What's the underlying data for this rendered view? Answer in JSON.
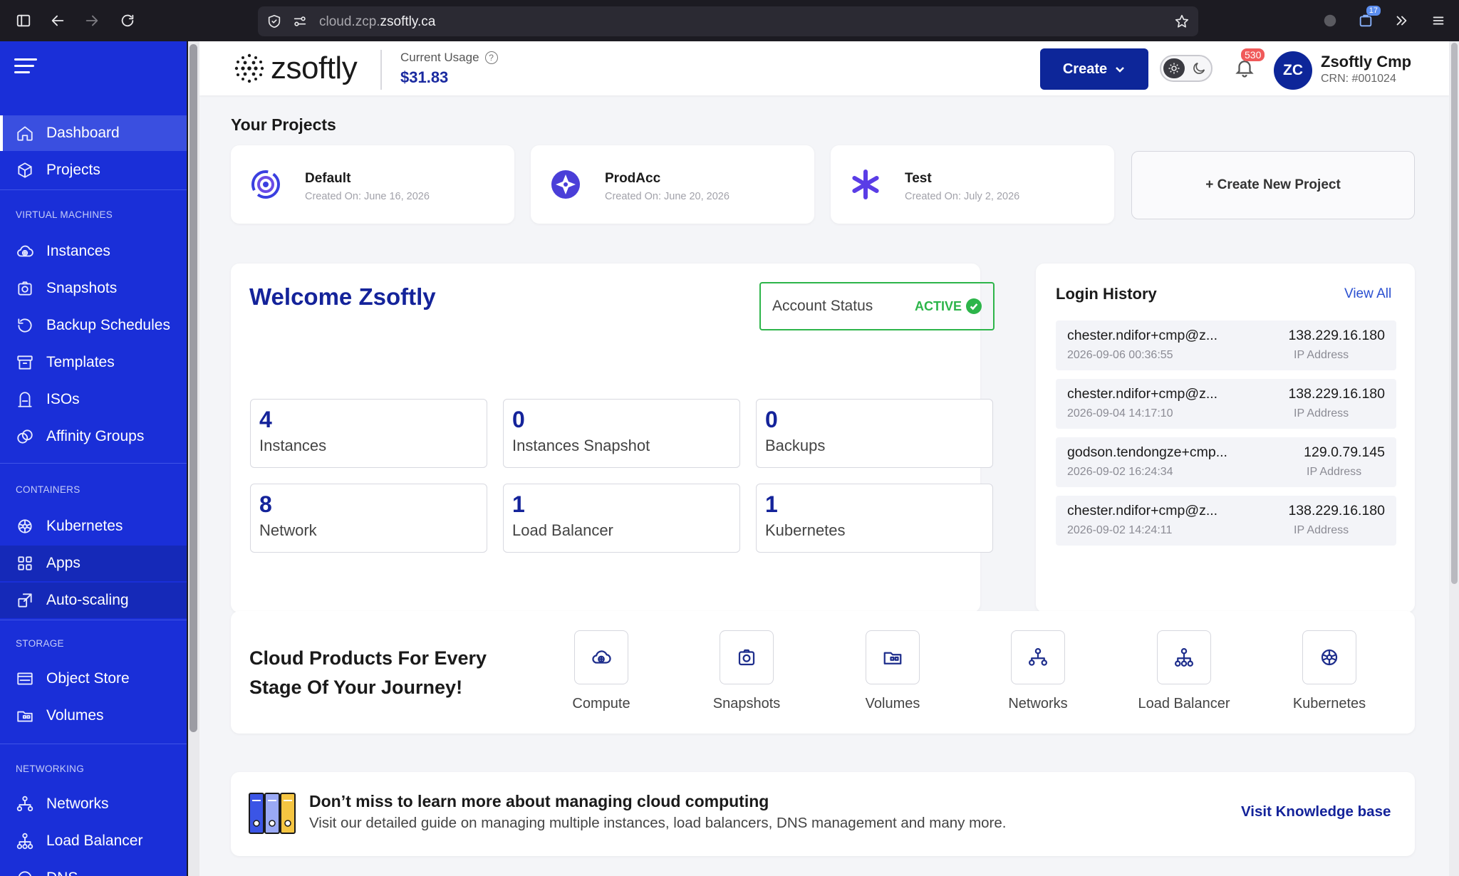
{
  "browser": {
    "url_host_prefix": "cloud.zcp.",
    "url_host_domain": "zsoftly.ca",
    "extension_badge": "17"
  },
  "sidebar": {
    "items_top": [
      {
        "label": "Dashboard",
        "icon": "home-icon",
        "active": true
      },
      {
        "label": "Projects",
        "icon": "cube-icon"
      }
    ],
    "sections": [
      {
        "title": "VIRTUAL MACHINES",
        "items": [
          {
            "label": "Instances",
            "icon": "cloud-plus-icon"
          },
          {
            "label": "Snapshots",
            "icon": "camera-icon"
          },
          {
            "label": "Backup Schedules",
            "icon": "history-icon"
          },
          {
            "label": "Templates",
            "icon": "archive-icon"
          },
          {
            "label": "ISOs",
            "icon": "disc-icon"
          },
          {
            "label": "Affinity Groups",
            "icon": "affinity-icon"
          }
        ]
      },
      {
        "title": "CONTAINERS",
        "items": [
          {
            "label": "Kubernetes",
            "icon": "kubernetes-icon"
          },
          {
            "label": "Apps",
            "icon": "apps-icon"
          },
          {
            "label": "Auto-scaling",
            "icon": "autoscale-icon"
          }
        ]
      },
      {
        "title": "STORAGE",
        "items": [
          {
            "label": "Object Store",
            "icon": "object-store-icon"
          },
          {
            "label": "Volumes",
            "icon": "volumes-icon"
          }
        ]
      },
      {
        "title": "NETWORKING",
        "items": [
          {
            "label": "Networks",
            "icon": "network-icon"
          },
          {
            "label": "Load Balancer",
            "icon": "load-balancer-icon"
          },
          {
            "label": "DNS",
            "icon": "dns-icon"
          }
        ]
      }
    ]
  },
  "header": {
    "logo_text": "zsoftly",
    "usage_label": "Current Usage",
    "usage_value": "$31.83",
    "create_label": "Create",
    "notification_count": "530",
    "avatar_initials": "ZC",
    "user_name": "Zsoftly Cmp",
    "user_crn": "CRN: #001024"
  },
  "projects": {
    "title": "Your Projects",
    "items": [
      {
        "name": "Default",
        "created": "Created On: June 16, 2026"
      },
      {
        "name": "ProdAcc",
        "created": "Created On: June 20, 2026"
      },
      {
        "name": "Test",
        "created": "Created On: July 2, 2026"
      }
    ],
    "create_label": "+ Create New Project"
  },
  "welcome": {
    "title": "Welcome Zsoftly",
    "account_status_label": "Account Status",
    "account_status_value": "ACTIVE",
    "stats": [
      {
        "value": "4",
        "label": "Instances"
      },
      {
        "value": "0",
        "label": "Instances Snapshot"
      },
      {
        "value": "0",
        "label": "Backups"
      },
      {
        "value": "8",
        "label": "Network"
      },
      {
        "value": "1",
        "label": "Load Balancer"
      },
      {
        "value": "1",
        "label": "Kubernetes"
      }
    ]
  },
  "login_history": {
    "title": "Login History",
    "view_all": "View All",
    "entries": [
      {
        "email": "chester.ndifor+cmp@z...",
        "time": "2026-09-06 00:36:55",
        "ip": "138.229.16.180",
        "ip_label": "IP Address"
      },
      {
        "email": "chester.ndifor+cmp@z...",
        "time": "2026-09-04 14:17:10",
        "ip": "138.229.16.180",
        "ip_label": "IP Address"
      },
      {
        "email": "godson.tendongze+cmp...",
        "time": "2026-09-02 16:24:34",
        "ip": "129.0.79.145",
        "ip_label": "IP Address"
      },
      {
        "email": "chester.ndifor+cmp@z...",
        "time": "2026-09-02 14:24:11",
        "ip": "138.229.16.180",
        "ip_label": "IP Address"
      }
    ]
  },
  "cloud_products": {
    "title": "Cloud Products For Every Stage Of Your Journey!",
    "items": [
      {
        "label": "Compute",
        "icon": "compute-icon"
      },
      {
        "label": "Snapshots",
        "icon": "snapshot-icon"
      },
      {
        "label": "Volumes",
        "icon": "volumes-icon"
      },
      {
        "label": "Networks",
        "icon": "network-icon"
      },
      {
        "label": "Load Balancer",
        "icon": "load-balancer-icon"
      },
      {
        "label": "Kubernetes",
        "icon": "kubernetes-icon"
      }
    ]
  },
  "knowledge": {
    "title": "Don’t miss to learn more about managing cloud computing",
    "description": "Visit our detailed guide on managing multiple instances, load balancers, DNS management and many more.",
    "link": "Visit Knowledge base"
  },
  "colors": {
    "sidebar": "#1a2fd8",
    "primary": "#0d2699",
    "accent_text": "#14239a",
    "success": "#2db54a",
    "badge": "#f05a5a"
  }
}
